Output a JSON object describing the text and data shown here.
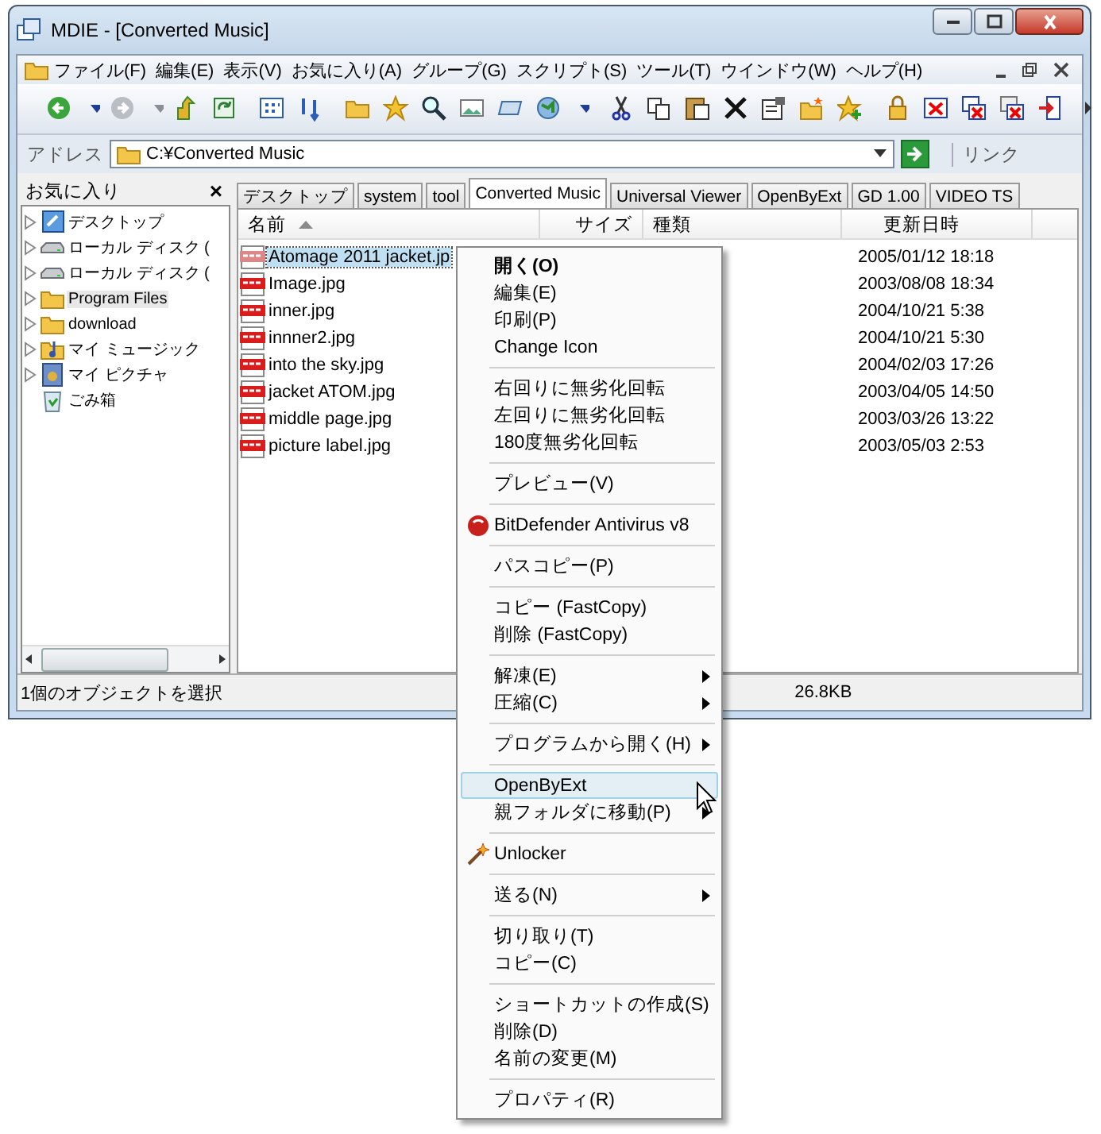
{
  "window": {
    "title": "MDIE - [Converted Music]"
  },
  "menu_bar": [
    "ファイル(F)",
    "編集(E)",
    "表示(V)",
    "お気に入り(A)",
    "グループ(G)",
    "スクリプト(S)",
    "ツール(T)",
    "ウインドウ(W)",
    "ヘルプ(H)"
  ],
  "address_bar": {
    "label": "アドレス",
    "value": "C:¥Converted Music",
    "links_label": "リンク"
  },
  "favorites_pane": {
    "title": "お気に入り",
    "close": "×",
    "tree": [
      {
        "label": "デスクトップ",
        "kind": "desktop",
        "expander": true,
        "highlighted": false
      },
      {
        "label": "ローカル ディスク (",
        "kind": "drive",
        "expander": true,
        "highlighted": false
      },
      {
        "label": "ローカル ディスク (",
        "kind": "drive",
        "expander": true,
        "highlighted": false
      },
      {
        "label": "Program Files",
        "kind": "folder",
        "expander": true,
        "highlighted": true
      },
      {
        "label": "download",
        "kind": "folder",
        "expander": true,
        "highlighted": false
      },
      {
        "label": "マイ ミュージック",
        "kind": "music",
        "expander": true,
        "highlighted": false
      },
      {
        "label": "マイ ピクチャ",
        "kind": "pictures",
        "expander": true,
        "highlighted": false
      },
      {
        "label": "ごみ箱",
        "kind": "trash",
        "expander": false,
        "highlighted": false
      }
    ]
  },
  "tabs": [
    {
      "label": "デスクトップ",
      "selected": false
    },
    {
      "label": "system",
      "selected": false
    },
    {
      "label": "tool",
      "selected": false
    },
    {
      "label": "Converted Music",
      "selected": true
    },
    {
      "label": "Universal Viewer",
      "selected": false
    },
    {
      "label": "OpenByExt",
      "selected": false
    },
    {
      "label": "GD 1.00",
      "selected": false
    },
    {
      "label": "VIDEO TS",
      "selected": false
    }
  ],
  "file_list": {
    "columns": [
      {
        "label": "名前",
        "sorted": true
      },
      {
        "label": "サイズ",
        "sorted": false
      },
      {
        "label": "種類",
        "sorted": false
      },
      {
        "label": "更新日時",
        "sorted": false
      }
    ],
    "rows": [
      {
        "name": "Atomage 2011 jacket.jp",
        "modified": "2005/01/12 18:18",
        "selected": true
      },
      {
        "name": "Image.jpg",
        "modified": "2003/08/08 18:34",
        "selected": false
      },
      {
        "name": "inner.jpg",
        "modified": "2004/10/21 5:38",
        "selected": false
      },
      {
        "name": "innner2.jpg",
        "modified": "2004/10/21 5:30",
        "selected": false
      },
      {
        "name": "into the sky.jpg",
        "modified": "2004/02/03 17:26",
        "selected": false
      },
      {
        "name": "jacket ATOM.jpg",
        "modified": "2003/04/05 14:50",
        "selected": false
      },
      {
        "name": "middle page.jpg",
        "modified": "2003/03/26 13:22",
        "selected": false
      },
      {
        "name": "picture label.jpg",
        "modified": "2003/05/03 2:53",
        "selected": false
      }
    ]
  },
  "status_bar": {
    "selection": "1個のオブジェクトを選択",
    "size": "26.8KB"
  },
  "context_menu": [
    {
      "kind": "item",
      "label": "開く(O)",
      "default": true,
      "submenu": false,
      "selected": false
    },
    {
      "kind": "item",
      "label": "編集(E)",
      "default": false,
      "submenu": false,
      "selected": false
    },
    {
      "kind": "item",
      "label": "印刷(P)",
      "default": false,
      "submenu": false,
      "selected": false
    },
    {
      "kind": "item",
      "label": "Change Icon",
      "default": false,
      "submenu": false,
      "selected": false
    },
    {
      "kind": "separator"
    },
    {
      "kind": "item",
      "label": "右回りに無劣化回転",
      "default": false,
      "submenu": false,
      "selected": false
    },
    {
      "kind": "item",
      "label": "左回りに無劣化回転",
      "default": false,
      "submenu": false,
      "selected": false
    },
    {
      "kind": "item",
      "label": "180度無劣化回転",
      "default": false,
      "submenu": false,
      "selected": false
    },
    {
      "kind": "separator"
    },
    {
      "kind": "item",
      "label": "プレビュー(V)",
      "default": false,
      "submenu": false,
      "selected": false
    },
    {
      "kind": "separator"
    },
    {
      "kind": "antivirus",
      "label": "BitDefender Antivirus v8",
      "default": false,
      "submenu": false,
      "selected": false
    },
    {
      "kind": "separator"
    },
    {
      "kind": "item",
      "label": "パスコピー(P)",
      "default": false,
      "submenu": false,
      "selected": false
    },
    {
      "kind": "separator"
    },
    {
      "kind": "item",
      "label": "コピー (FastCopy)",
      "default": false,
      "submenu": false,
      "selected": false
    },
    {
      "kind": "item",
      "label": "削除 (FastCopy)",
      "default": false,
      "submenu": false,
      "selected": false
    },
    {
      "kind": "separator"
    },
    {
      "kind": "item",
      "label": "解凍(E)",
      "default": false,
      "submenu": true,
      "selected": false
    },
    {
      "kind": "item",
      "label": "圧縮(C)",
      "default": false,
      "submenu": true,
      "selected": false
    },
    {
      "kind": "separator"
    },
    {
      "kind": "item",
      "label": "プログラムから開く(H)",
      "default": false,
      "submenu": true,
      "selected": false
    },
    {
      "kind": "separator"
    },
    {
      "kind": "item",
      "label": "OpenByExt",
      "default": false,
      "submenu": false,
      "selected": true
    },
    {
      "kind": "item",
      "label": "親フォルダに移動(P)",
      "default": false,
      "submenu": true,
      "selected": false
    },
    {
      "kind": "separator"
    },
    {
      "kind": "unlocker",
      "label": "Unlocker",
      "default": false,
      "submenu": false,
      "selected": false
    },
    {
      "kind": "separator"
    },
    {
      "kind": "item",
      "label": "送る(N)",
      "default": false,
      "submenu": true,
      "selected": false
    },
    {
      "kind": "separator"
    },
    {
      "kind": "item",
      "label": "切り取り(T)",
      "default": false,
      "submenu": false,
      "selected": false
    },
    {
      "kind": "item",
      "label": "コピー(C)",
      "default": false,
      "submenu": false,
      "selected": false
    },
    {
      "kind": "separator"
    },
    {
      "kind": "item",
      "label": "ショートカットの作成(S)",
      "default": false,
      "submenu": false,
      "selected": false
    },
    {
      "kind": "item",
      "label": "削除(D)",
      "default": false,
      "submenu": false,
      "selected": false
    },
    {
      "kind": "item",
      "label": "名前の変更(M)",
      "default": false,
      "submenu": false,
      "selected": false
    },
    {
      "kind": "separator"
    },
    {
      "kind": "item",
      "label": "プロパティ(R)",
      "default": false,
      "submenu": false,
      "selected": false
    }
  ]
}
